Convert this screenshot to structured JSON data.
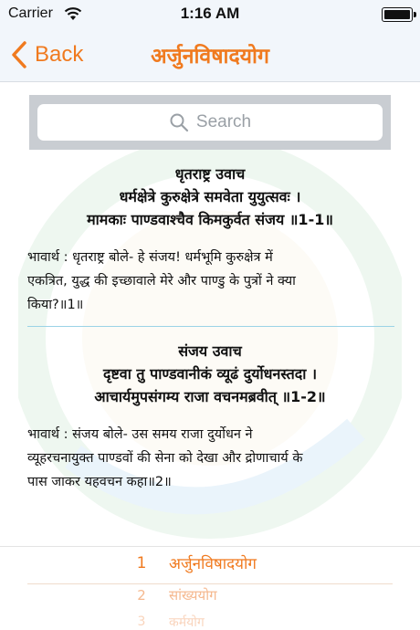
{
  "status_bar": {
    "carrier": "Carrier",
    "time": "1:16 AM"
  },
  "nav": {
    "back_label": "Back",
    "title": "अर्जुनविषादयोग"
  },
  "search": {
    "placeholder": "Search"
  },
  "verses": [
    {
      "speaker": "धृतराष्ट्र उवाच",
      "lines": [
        "धर्मक्षेत्रे कुरुक्षेत्रे समवेता युयुत्सवः ।",
        "मामकाः पाण्डवाश्चैव किमकुर्वत संजय ॥1-1॥"
      ],
      "meaning_lines": [
        "भावार्थ :  धृतराष्ट्र बोले- हे संजय! धर्मभूमि कुरुक्षेत्र में",
        "एकत्रित, युद्ध की इच्छावाले मेरे और पाण्डु के पुत्रों ने क्या",
        "किया?॥1॥"
      ]
    },
    {
      "speaker": "संजय उवाच",
      "lines": [
        "दृष्टवा तु पाण्डवानीकं व्यूढं दुर्योधनस्तदा ।",
        "आचार्यमुपसंगम्य राजा वचनमब्रवीत्‌ ॥1-2॥"
      ],
      "meaning_lines": [
        "भावार्थ :  संजय बोले- उस समय राजा दुर्योधन ने",
        "व्यूहरचनायुक्त पाण्डवों की सेना को देखा और द्रोणाचार्य के",
        "पास जाकर यहवचन कहा॥2॥"
      ]
    }
  ],
  "chapters": [
    {
      "number": "1",
      "name": "अर्जुनविषादयोग"
    },
    {
      "number": "2",
      "name": "सांख्ययोग"
    },
    {
      "number": "3",
      "name": "कर्मयोग"
    }
  ],
  "colors": {
    "accent": "#f07a1f",
    "divider": "#9bd3e6"
  },
  "icons": {
    "back": "chevron-left-icon",
    "search": "search-icon",
    "wifi": "wifi-icon",
    "battery": "battery-icon"
  }
}
